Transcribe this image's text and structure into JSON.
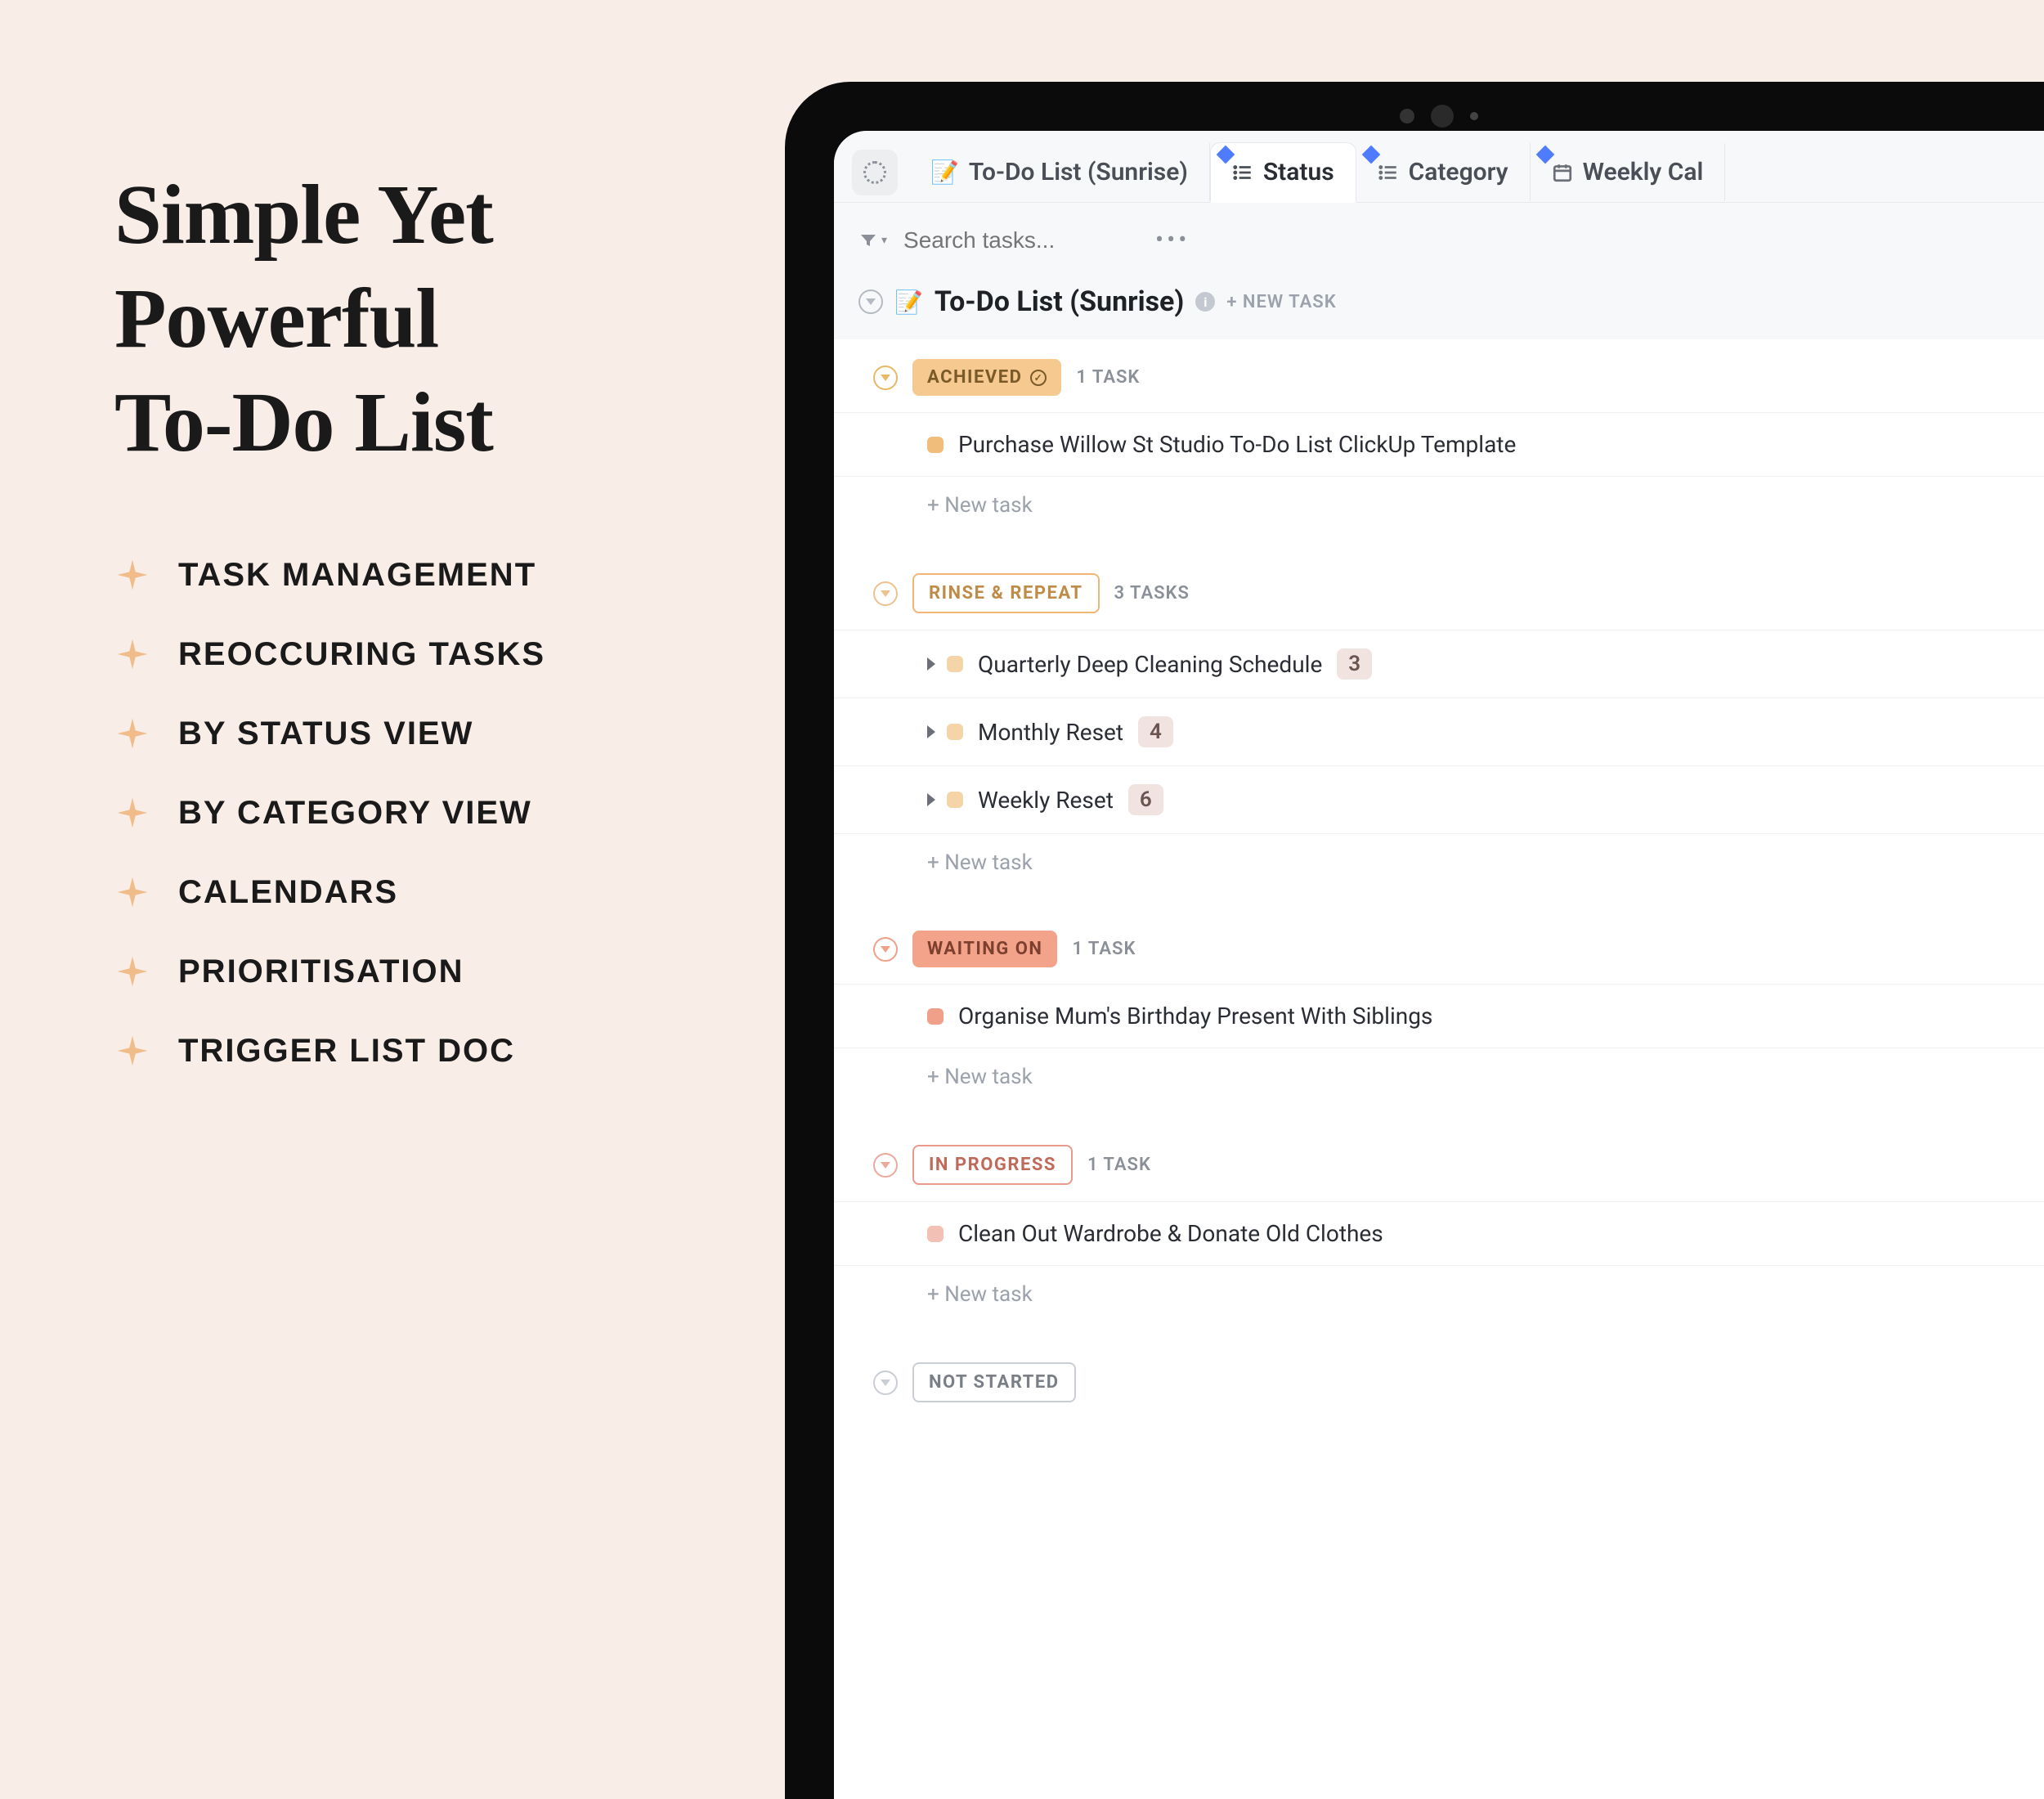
{
  "marketing": {
    "headline_line1": "Simple Yet",
    "headline_line2": "Powerful",
    "headline_line3": "To-Do List",
    "features": [
      "TASK MANAGEMENT",
      "REOCCURING TASKS",
      "BY STATUS VIEW",
      "BY CATEGORY VIEW",
      "CALENDARS",
      "PRIORITISATION",
      "TRIGGER LIST DOC"
    ]
  },
  "tabs": {
    "breadcrumb": "To-Do List (Sunrise)",
    "status": "Status",
    "category": "Category",
    "weekly_cal": "Weekly Cal"
  },
  "toolbar": {
    "search_placeholder": "Search tasks..."
  },
  "list": {
    "title": "To-Do List (Sunrise)",
    "new_task_label": "+ NEW TASK"
  },
  "groups": [
    {
      "status": "ACHIEVED",
      "count_label": "1 TASK",
      "style": "achieved",
      "show_check": true,
      "tasks": [
        {
          "title": "Purchase Willow St Studio To-Do List ClickUp Template",
          "has_caret": false,
          "subtask_count": null
        }
      ],
      "new_task": "+ New task"
    },
    {
      "status": "RINSE & REPEAT",
      "count_label": "3 TASKS",
      "style": "rinse",
      "show_check": false,
      "tasks": [
        {
          "title": "Quarterly Deep Cleaning Schedule",
          "has_caret": true,
          "subtask_count": "3"
        },
        {
          "title": "Monthly Reset",
          "has_caret": true,
          "subtask_count": "4"
        },
        {
          "title": "Weekly Reset",
          "has_caret": true,
          "subtask_count": "6"
        }
      ],
      "new_task": "+ New task"
    },
    {
      "status": "WAITING ON",
      "count_label": "1 TASK",
      "style": "waiting",
      "show_check": false,
      "tasks": [
        {
          "title": "Organise Mum's Birthday Present With Siblings",
          "has_caret": false,
          "subtask_count": null
        }
      ],
      "new_task": "+ New task"
    },
    {
      "status": "IN PROGRESS",
      "count_label": "1 TASK",
      "style": "inprog",
      "show_check": false,
      "tasks": [
        {
          "title": "Clean Out Wardrobe & Donate Old Clothes",
          "has_caret": false,
          "subtask_count": null
        }
      ],
      "new_task": "+ New task"
    },
    {
      "status": "NOT STARTED",
      "count_label": "",
      "style": "notstart",
      "show_check": false,
      "tasks": [],
      "new_task": ""
    }
  ]
}
